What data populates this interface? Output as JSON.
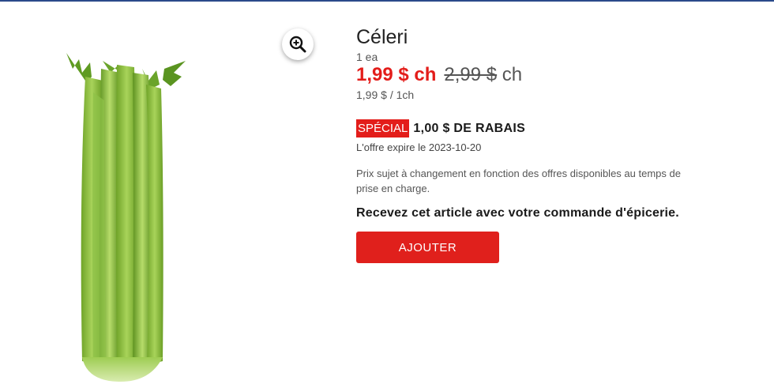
{
  "product": {
    "name": "Céleri",
    "unit": "1 ea",
    "price_now": "1,99 $ ch",
    "price_was": "2,99 $",
    "price_was_suffix": " ch",
    "price_per": "1,99 $ / 1ch"
  },
  "promo": {
    "badge": "SPÉCIAL",
    "rebate": "1,00 $ DE RABAIS",
    "expires": "L'offre expire le 2023-10-20"
  },
  "disclaimer": "Prix sujet à changement en fonction des offres disponibles au temps de prise en charge.",
  "notice": "Recevez cet article avec votre commande d'épicerie.",
  "actions": {
    "add_label": "AJOUTER"
  },
  "icons": {
    "zoom": "zoom-in-icon"
  },
  "colors": {
    "accent": "#e31d1a",
    "top_rule": "#2a4a8a"
  }
}
